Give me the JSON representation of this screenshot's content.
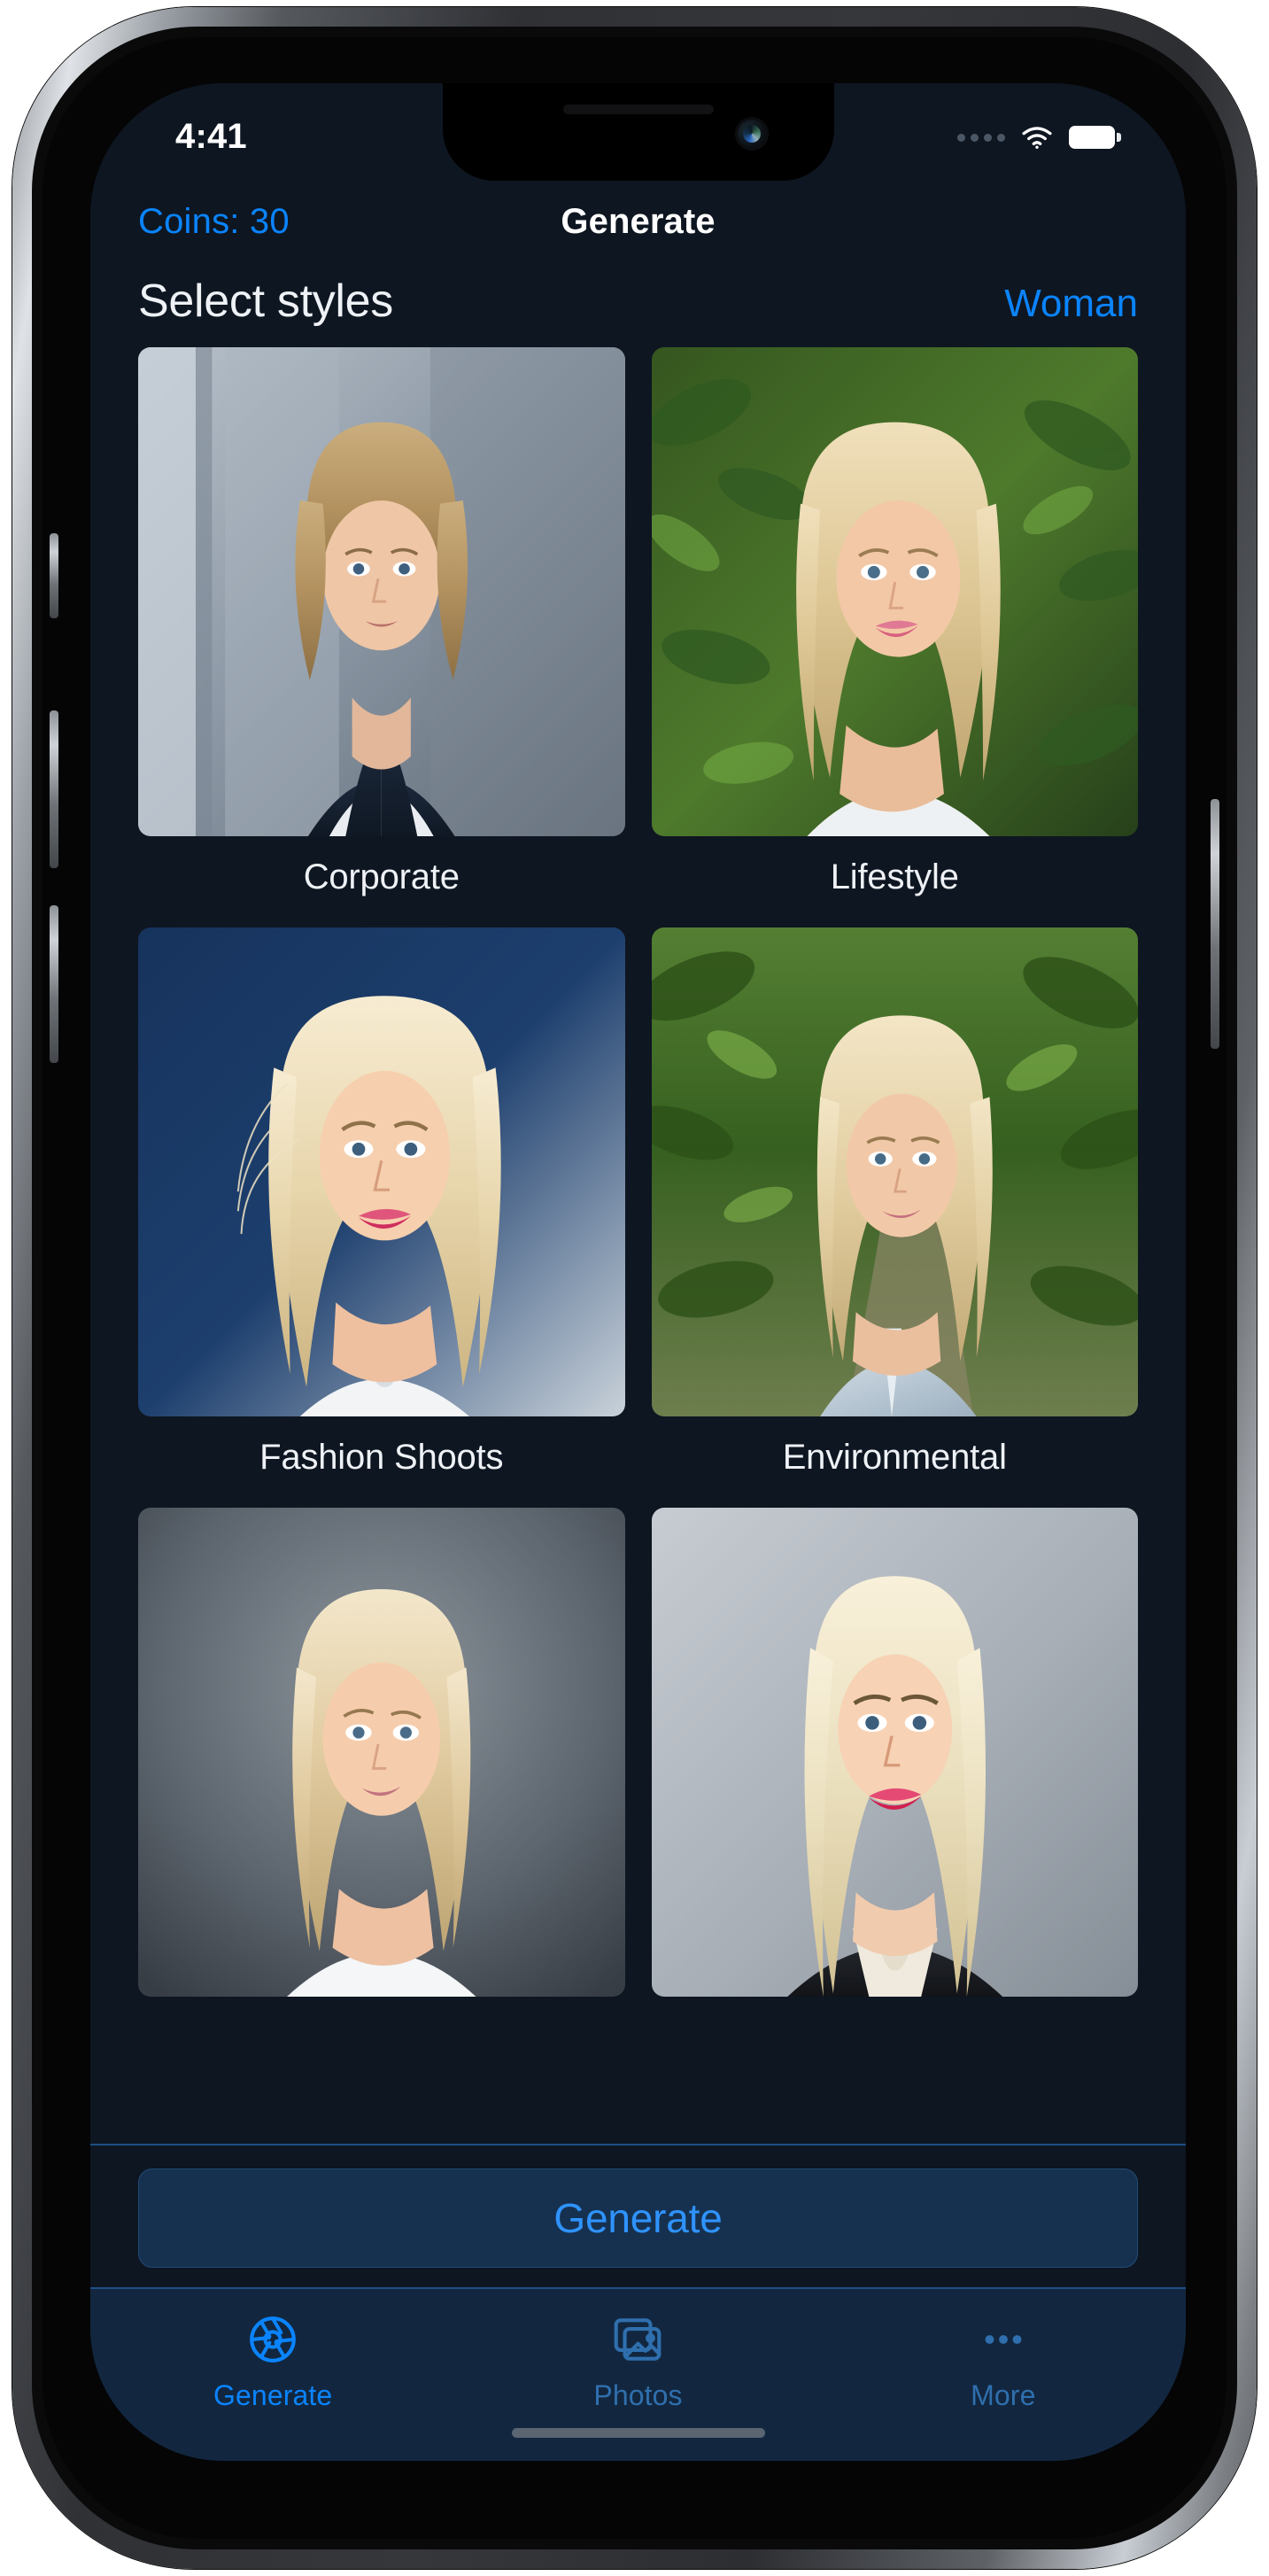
{
  "status_bar": {
    "time": "4:41",
    "signal_icon": "signal-dots-icon",
    "wifi_icon": "wifi-icon",
    "battery_icon": "battery-full-icon"
  },
  "nav_bar": {
    "coins_label": "Coins: 30",
    "title": "Generate"
  },
  "section": {
    "title": "Select styles",
    "action_label": "Woman"
  },
  "colors": {
    "accent": "#0a84ff",
    "background": "#0e1621",
    "tabbar_background": "#12273f",
    "cta_background": "#16314f",
    "cta_text": "#2f93ff",
    "separator": "#1d4f86"
  },
  "styles_grid": [
    {
      "label": "Corporate"
    },
    {
      "label": "Lifestyle"
    },
    {
      "label": "Fashion Shoots"
    },
    {
      "label": "Environmental"
    },
    {
      "label": ""
    },
    {
      "label": ""
    }
  ],
  "cta": {
    "label": "Generate"
  },
  "tab_bar": {
    "items": [
      {
        "label": "Generate",
        "icon": "aperture-icon",
        "active": true
      },
      {
        "label": "Photos",
        "icon": "photo-stack-icon",
        "active": false
      },
      {
        "label": "More",
        "icon": "ellipsis-icon",
        "active": false
      }
    ]
  }
}
